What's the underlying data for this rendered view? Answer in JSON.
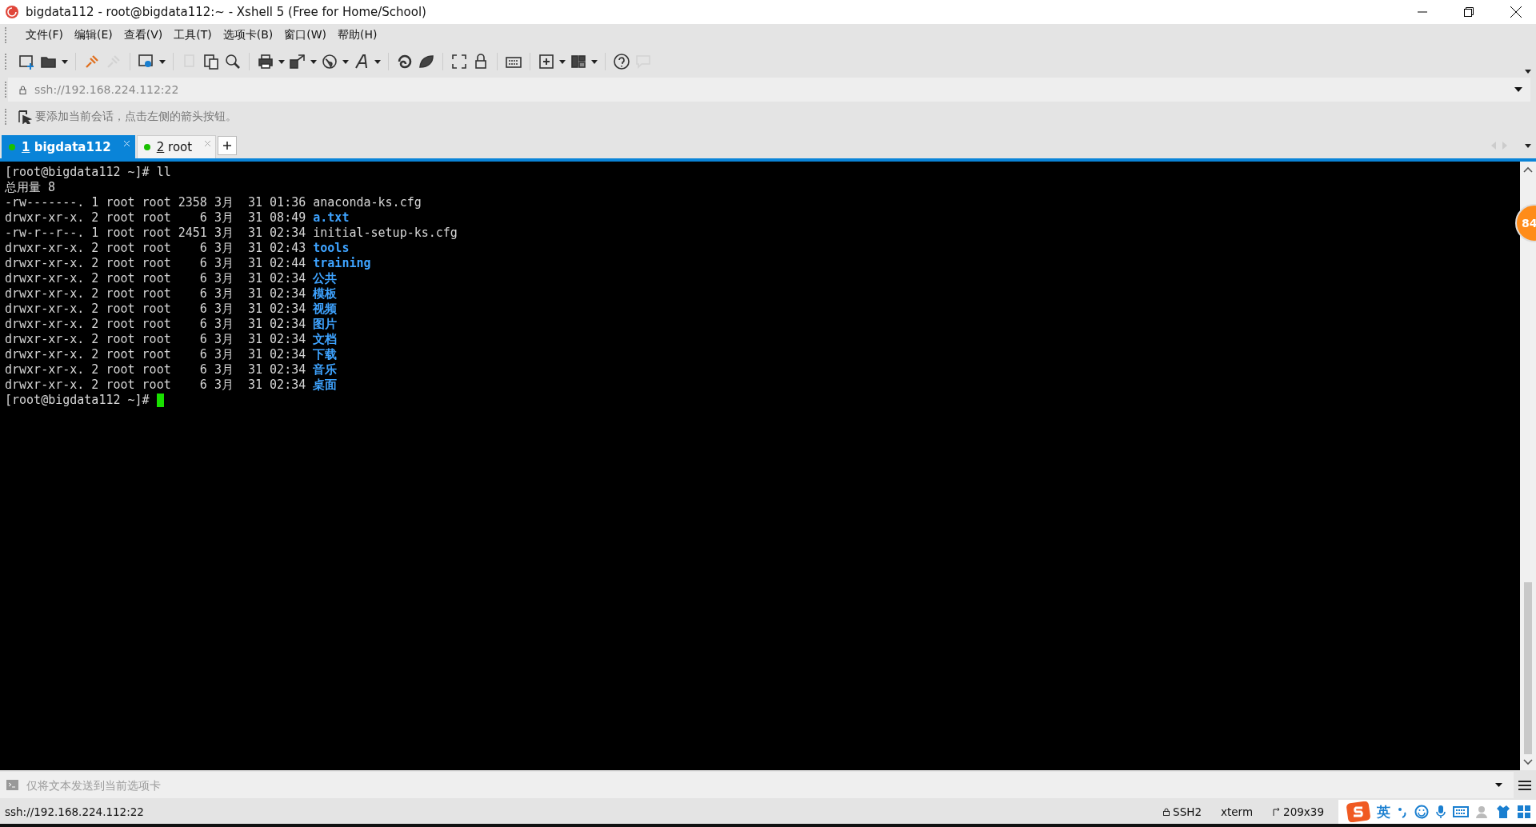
{
  "window": {
    "title": "bigdata112 - root@bigdata112:~ - Xshell 5 (Free for Home/School)"
  },
  "menu": [
    "文件(F)",
    "编辑(E)",
    "查看(V)",
    "工具(T)",
    "选项卡(B)",
    "窗口(W)",
    "帮助(H)"
  ],
  "address_bar": {
    "value": "ssh://192.168.224.112:22"
  },
  "session_hint": "要添加当前会话，点击左侧的箭头按钮。",
  "tabs": [
    {
      "number": "1",
      "label": "bigdata112",
      "selected": true
    },
    {
      "number": "2",
      "label": "root",
      "selected": false
    }
  ],
  "terminal": {
    "lines": [
      {
        "kind": "prompt",
        "text": "[root@bigdata112 ~]# ll",
        "cursor": false
      },
      {
        "kind": "plain",
        "text": "总用量 8"
      },
      {
        "kind": "entry",
        "text": "-rw-------. 1 root root 2358 3月  31 01:36 ",
        "name": "anaconda-ks.cfg",
        "dir": false
      },
      {
        "kind": "entry",
        "text": "drwxr-xr-x. 2 root root    6 3月  31 08:49 ",
        "name": "a.txt",
        "dir": true
      },
      {
        "kind": "entry",
        "text": "-rw-r--r--. 1 root root 2451 3月  31 02:34 ",
        "name": "initial-setup-ks.cfg",
        "dir": false
      },
      {
        "kind": "entry",
        "text": "drwxr-xr-x. 2 root root    6 3月  31 02:43 ",
        "name": "tools",
        "dir": true
      },
      {
        "kind": "entry",
        "text": "drwxr-xr-x. 2 root root    6 3月  31 02:44 ",
        "name": "training",
        "dir": true
      },
      {
        "kind": "entry",
        "text": "drwxr-xr-x. 2 root root    6 3月  31 02:34 ",
        "name": "公共",
        "dir": true
      },
      {
        "kind": "entry",
        "text": "drwxr-xr-x. 2 root root    6 3月  31 02:34 ",
        "name": "模板",
        "dir": true
      },
      {
        "kind": "entry",
        "text": "drwxr-xr-x. 2 root root    6 3月  31 02:34 ",
        "name": "视频",
        "dir": true
      },
      {
        "kind": "entry",
        "text": "drwxr-xr-x. 2 root root    6 3月  31 02:34 ",
        "name": "图片",
        "dir": true
      },
      {
        "kind": "entry",
        "text": "drwxr-xr-x. 2 root root    6 3月  31 02:34 ",
        "name": "文档",
        "dir": true
      },
      {
        "kind": "entry",
        "text": "drwxr-xr-x. 2 root root    6 3月  31 02:34 ",
        "name": "下载",
        "dir": true
      },
      {
        "kind": "entry",
        "text": "drwxr-xr-x. 2 root root    6 3月  31 02:34 ",
        "name": "音乐",
        "dir": true
      },
      {
        "kind": "entry",
        "text": "drwxr-xr-x. 2 root root    6 3月  31 02:34 ",
        "name": "桌面",
        "dir": true
      },
      {
        "kind": "prompt",
        "text": "[root@bigdata112 ~]# ",
        "cursor": true
      }
    ]
  },
  "floating_badge": "84",
  "compose_bar": {
    "placeholder": "仅将文本发送到当前选项卡"
  },
  "status_bar": {
    "address": "ssh://192.168.224.112:22",
    "protocol": "SSH2",
    "terminal_type": "xterm",
    "size": "209x39"
  },
  "ime_bar": {
    "mode": "英"
  }
}
